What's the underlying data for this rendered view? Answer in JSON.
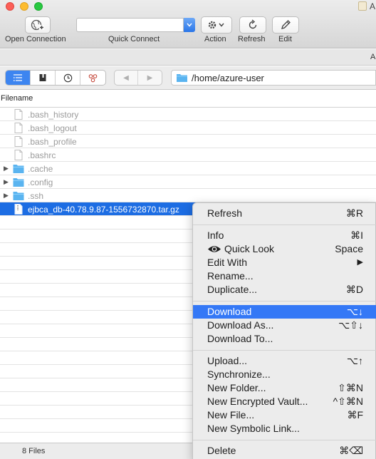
{
  "window": {
    "title": "A"
  },
  "toolbar": {
    "open_connection": "Open Connection",
    "quick_connect": "Quick Connect",
    "quick_connect_value": "",
    "action": "Action",
    "refresh": "Refresh",
    "edit": "Edit"
  },
  "subbar": {
    "text": "A"
  },
  "navigation": {
    "path": "/home/azure-user"
  },
  "columns": {
    "filename": "Filename"
  },
  "files": [
    {
      "name": ".bash_history",
      "type": "file"
    },
    {
      "name": ".bash_logout",
      "type": "file"
    },
    {
      "name": ".bash_profile",
      "type": "file"
    },
    {
      "name": ".bashrc",
      "type": "file"
    },
    {
      "name": ".cache",
      "type": "folder"
    },
    {
      "name": ".config",
      "type": "folder"
    },
    {
      "name": ".ssh",
      "type": "folder"
    },
    {
      "name": "ejbca_db-40.78.9.87-1556732870.tar.gz",
      "type": "file",
      "selected": true
    }
  ],
  "status": {
    "text": "8 Files"
  },
  "context_menu": {
    "items": [
      {
        "label": "Refresh",
        "shortcut": "⌘R"
      },
      {
        "label": "Info",
        "shortcut": "⌘I"
      },
      {
        "label": "Quick Look",
        "shortcut": "Space"
      },
      {
        "label": "Edit With",
        "shortcut": "▶"
      },
      {
        "label": "Rename...",
        "shortcut": ""
      },
      {
        "label": "Duplicate...",
        "shortcut": "⌘D"
      },
      {
        "label": "Download",
        "shortcut": "⌥↓",
        "highlighted": true
      },
      {
        "label": "Download As...",
        "shortcut": "⌥⇧↓"
      },
      {
        "label": "Download To...",
        "shortcut": ""
      },
      {
        "label": "Upload...",
        "shortcut": "⌥↑"
      },
      {
        "label": "Synchronize...",
        "shortcut": ""
      },
      {
        "label": "New Folder...",
        "shortcut": "⇧⌘N"
      },
      {
        "label": "New Encrypted Vault...",
        "shortcut": "^⇧⌘N"
      },
      {
        "label": "New File...",
        "shortcut": "⌘F"
      },
      {
        "label": "New Symbolic Link...",
        "shortcut": ""
      },
      {
        "label": "Delete",
        "shortcut": "⌘⌫"
      }
    ]
  },
  "colors": {
    "selection": "#1d6de3",
    "menu_highlight": "#3478f6",
    "folder": "#5ab4f0"
  }
}
